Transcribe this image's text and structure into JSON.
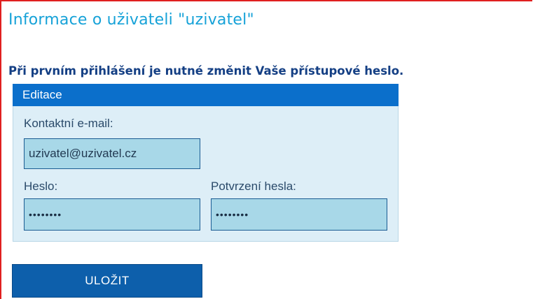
{
  "page": {
    "title": "Informace o uživateli \"uzivatel\"",
    "notice": "Při prvním přihlášení je nutné změnit Vaše přístupové heslo."
  },
  "panel": {
    "header": "Editace",
    "email": {
      "label": "Kontaktní e-mail:",
      "value": "uzivatel@uzivatel.cz"
    },
    "password": {
      "label": "Heslo:",
      "value": "••••••••"
    },
    "password_confirm": {
      "label": "Potvrzení hesla:",
      "value": "••••••••"
    }
  },
  "actions": {
    "save_label": "ULOŽIT"
  },
  "colors": {
    "title": "#16a2d8",
    "notice": "#143f84",
    "panel_bg": "#ddeef7",
    "panel_header": "#0b6fcb",
    "input_bg": "#a8d8e8",
    "button": "#0d5fab",
    "frame_border": "#e02020"
  }
}
